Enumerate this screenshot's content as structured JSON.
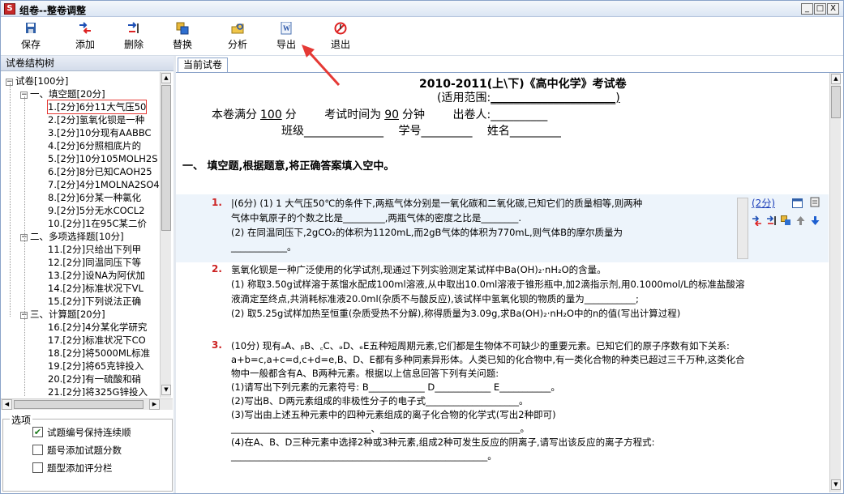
{
  "window": {
    "app_icon": "S",
    "title": "组卷--整卷调整",
    "minimize": "_",
    "maximize": "□",
    "close": "X"
  },
  "toolbar": [
    {
      "label": "保存",
      "icon": "save-icon"
    },
    {
      "label": "添加",
      "icon": "add-icon"
    },
    {
      "label": "删除",
      "icon": "delete-icon"
    },
    {
      "label": "替换",
      "icon": "replace-icon"
    },
    {
      "label": "分析",
      "icon": "analyze-icon"
    },
    {
      "label": "导出",
      "icon": "export-word-icon"
    },
    {
      "label": "退出",
      "icon": "exit-icon"
    }
  ],
  "left_pane": {
    "title": "试卷结构树",
    "tree": {
      "root": "试卷[100分]",
      "sections": [
        {
          "label": "一、填空题[20分]",
          "items": [
            "1.[2分]6分11大气压50",
            "2.[2分]氢氧化钡是一种",
            "3.[2分]10分现有AABBC",
            "4.[2分]6分照相底片的",
            "5.[2分]10分105MOLH2S",
            "6.[2分]8分已知CAOH25",
            "7.[2分]4分1MOLNA2SO4",
            "8.[2分]6分某一种氯化",
            "9.[2分]5分无水COCL2",
            "10.[2分]1在95C某二价"
          ]
        },
        {
          "label": "二、多项选择题[10分]",
          "items": [
            "11.[2分]只给出下列甲",
            "12.[2分]同温同压下等",
            "13.[2分]设NA为阿伏加",
            "14.[2分]标准状况下VL",
            "15.[2分]下列说法正确"
          ]
        },
        {
          "label": "三、计算题[20分]",
          "items": [
            "16.[2分]4分某化学研究",
            "17.[2分]标准状况下CO",
            "18.[2分]将5000ML标准",
            "19.[2分]将65克锌投入",
            "20.[2分]有一硫酸和硝",
            "21.[2分]将325G锌投入"
          ]
        }
      ]
    },
    "options": {
      "title": "选项",
      "items": [
        {
          "label": "试题编号保持连续顺",
          "checked": true
        },
        {
          "label": "题号添加试题分数",
          "checked": false
        },
        {
          "label": "题型添加评分栏",
          "checked": false
        }
      ]
    }
  },
  "right_pane": {
    "tab": "当前试卷",
    "header": {
      "title": "2010-2011(上\\下)《高中化学》考试卷",
      "scope_label": "(适用范围:",
      "scope_value": "______________________)",
      "full_score_label": "本卷满分",
      "full_score_value": "100",
      "full_score_unit": "分",
      "time_label": "考试时间为",
      "time_value": "90",
      "time_unit": "分钟",
      "author_label": "出卷人:",
      "author_blank": "__________",
      "class_label": "班级",
      "class_blank": "______________",
      "id_label": "学号",
      "id_blank": "_________",
      "name_label": "姓名",
      "name_blank": "_________"
    },
    "section_title": "一、 填空题,根据题意,将正确答案填入空中。",
    "questions": [
      {
        "num": "1.",
        "score": "(2分)",
        "lines": [
          "|(6分) (1) 1 大气压50℃的条件下,两瓶气体分别是一氧化碳和二氧化碳,已知它们的质量相等,则两种",
          "气体中氧原子的个数之比是_________,两瓶气体的密度之比是________.",
          "(2) 在同温同压下,2gCO₂的体积为1120mL,而2gB气体的体积为770mL,则气体B的摩尔质量为",
          "____________。"
        ]
      },
      {
        "num": "2.",
        "lines": [
          "氢氧化钡是一种广泛使用的化学试剂,现通过下列实验测定某试样中Ba(OH)₂·nH₂O的含量。",
          "  (1) 称取3.50g试样溶于蒸馏水配成100ml溶液,从中取出10.0ml溶液于锥形瓶中,加2滴指示剂,用0.1000mol/L的标准盐酸溶",
          "液滴定至终点,共消耗标准液20.0ml(杂质不与酸反应),该试样中氢氧化钡的物质的量为___________;",
          "  (2) 取5.25g试样加热至恒重(杂质受热不分解),称得质量为3.09g,求Ba(OH)₂·nH₂O中的n的值(写出计算过程)"
        ]
      },
      {
        "num": "3.",
        "lines": [
          "(10分) 现有ₐA、ᵦB、꜀C、ₔD、ₑE五种短周期元素,它们都是生物体不可缺少的重要元素。已知它们的原子序数有如下关系:",
          "a+b=c,a+c=d,c+d=e,B、D、E都有多种同素异形体。人类已知的化合物中,有一类化合物的种类已超过三千万种,这类化合",
          "物中一般都含有A、B两种元素。根据以上信息回答下列有关问题:",
          "(1)请写出下列元素的元素符号: B____________ D____________ E___________。",
          "(2)写出B、D两元素组成的非极性分子的电子式____________________。",
          "(3)写出由上述五种元素中的四种元素组成的离子化合物的化学式(写出2种即可)",
          "______________________________、______________________________。",
          "(4)在A、B、D三种元素中选择2种或3种元素,组成2种可发生反应的阴离子,请写出该反应的离子方程式:",
          "_______________________________________________________。"
        ]
      }
    ]
  },
  "colors": {
    "title_bar": "#dbe6f4",
    "question_number": "#cc2222",
    "score_link": "#1a3db8",
    "annotation_arrow": "#e53935",
    "highlight": "#edf4fb"
  }
}
